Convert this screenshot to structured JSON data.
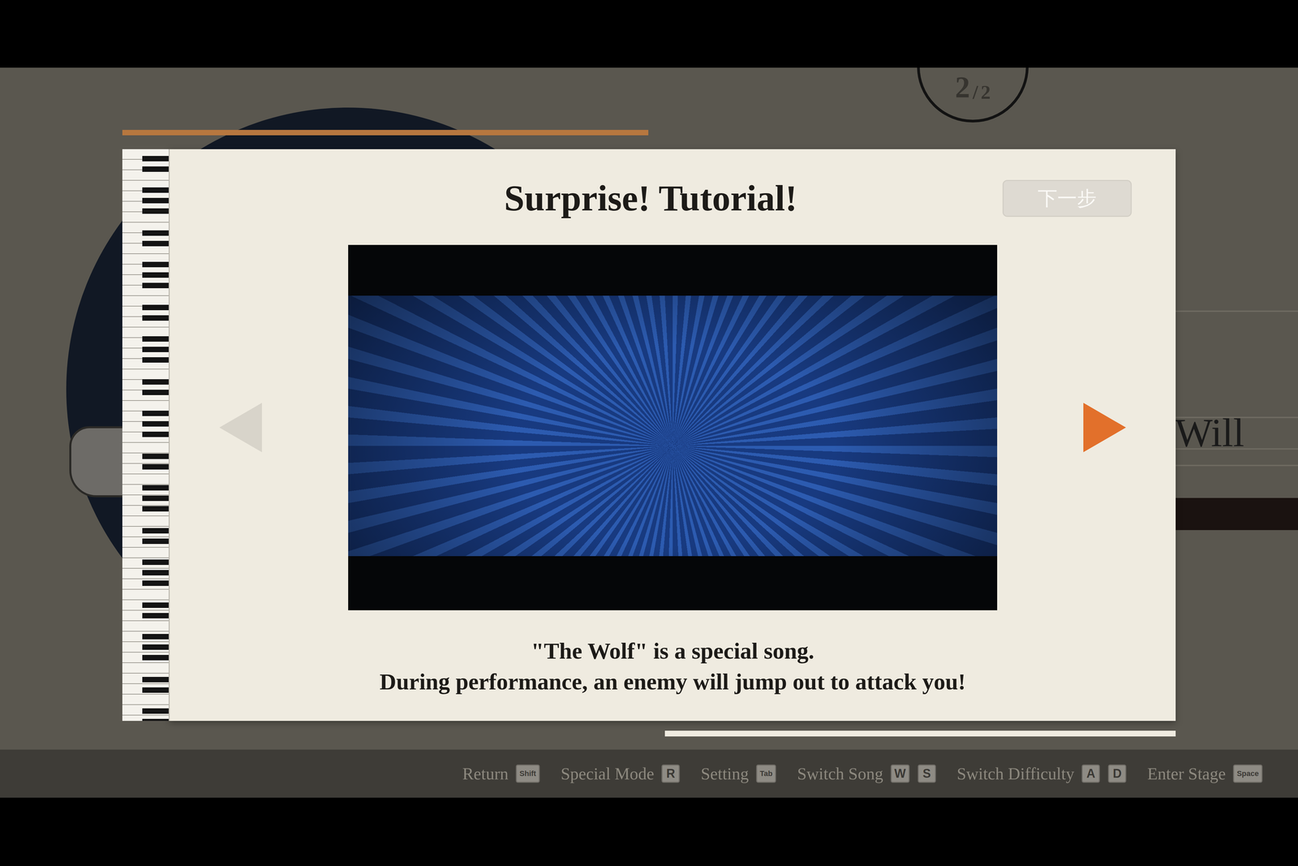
{
  "pager": {
    "current": "2",
    "separator": "/",
    "total": "2"
  },
  "background_song": {
    "title": "Will"
  },
  "dialog": {
    "title": "Surprise! Tutorial!",
    "next_button": "下一步",
    "prev_arrow": {
      "disabled": true
    },
    "next_arrow": {
      "disabled": false
    },
    "description": [
      "\"The Wolf\" is a special song.",
      "During performance, an enemy will jump out to attack you!"
    ]
  },
  "hints": [
    {
      "label": "Return",
      "keys": [
        "Shift"
      ]
    },
    {
      "label": "Special Mode",
      "keys": [
        "R"
      ]
    },
    {
      "label": "Setting",
      "keys": [
        "Tab"
      ]
    },
    {
      "label": "Switch Song",
      "keys": [
        "W",
        "S"
      ]
    },
    {
      "label": "Switch Difficulty",
      "keys": [
        "A",
        "D"
      ]
    },
    {
      "label": "Enter Stage",
      "keys": [
        "Space"
      ]
    }
  ]
}
